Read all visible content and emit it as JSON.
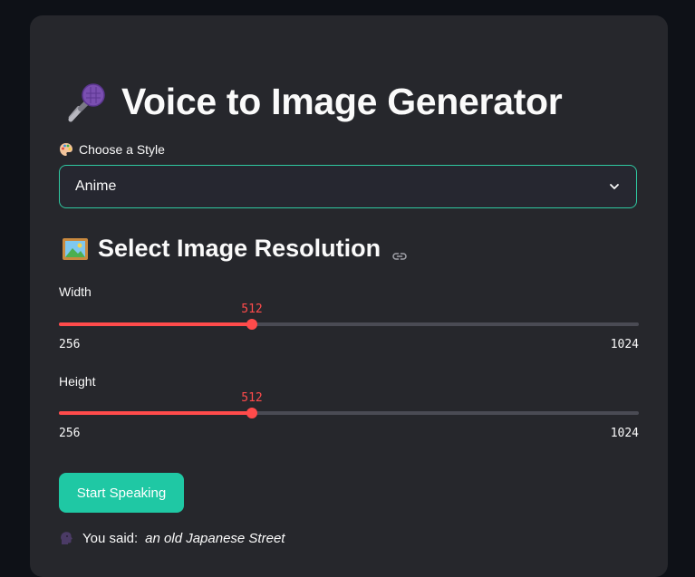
{
  "header": {
    "title": "Voice to Image Generator",
    "title_icon": "microphone-icon"
  },
  "style": {
    "label": "Choose a Style",
    "label_icon": "palette-icon",
    "selected": "Anime"
  },
  "resolution": {
    "title": "Select Image Resolution",
    "title_icon": "framed-picture-icon",
    "anchor_icon": "link-icon",
    "width": {
      "label": "Width",
      "value": 512,
      "min": 256,
      "max": 1024,
      "value_label": "512",
      "min_label": "256",
      "max_label": "1024"
    },
    "height": {
      "label": "Height",
      "value": 512,
      "min": 256,
      "max": 1024,
      "value_label": "512",
      "min_label": "256",
      "max_label": "1024"
    }
  },
  "actions": {
    "speak_label": "Start Speaking"
  },
  "transcript": {
    "icon": "speaking-head-icon",
    "prefix": "You said:",
    "text": "an old Japanese Street"
  },
  "colors": {
    "accent": "#1fc8a4",
    "slider": "#ff4b4b",
    "background": "#0e1117",
    "card": "#26272c"
  }
}
